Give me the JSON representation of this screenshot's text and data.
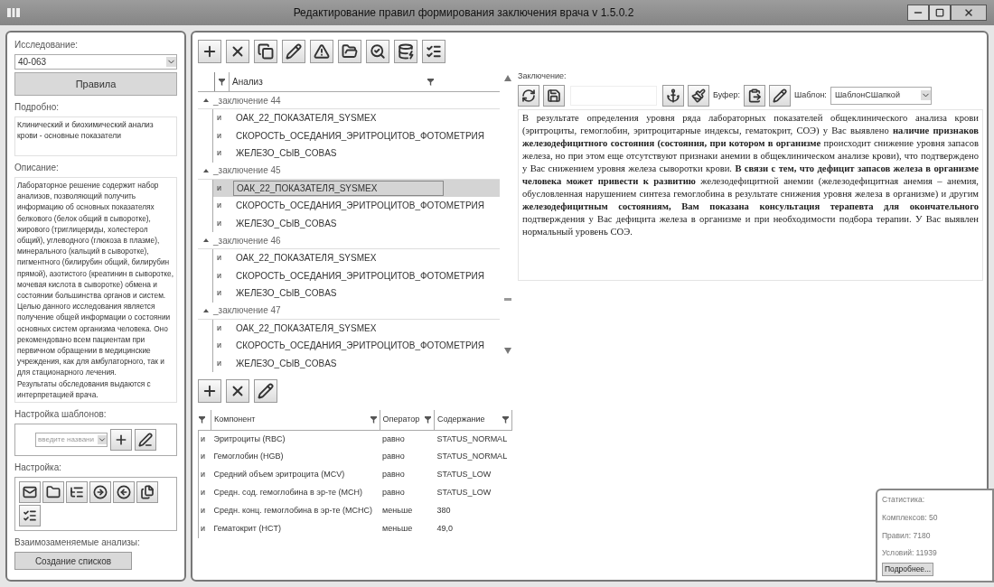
{
  "window": {
    "title": "Редактирование правил формирования заключения врача v 1.5.0.2"
  },
  "left": {
    "study_label": "Исследование:",
    "study_value": "40-063",
    "rules_button": "Правила",
    "details_label": "Подробно:",
    "details_text": "Клинический и биохимический анализ крови - основные показатели",
    "description_label": "Описание:",
    "description_text": "Лабораторное решение содержит набор анализов, позволяющий получить информацию об основных показателях белкового (белок общий в сыворотке), жирового (триглицериды, холестерол общий), углеводного (глюкоза в плазме), минерального (кальций в сыворотке), пигментного (билирубин общий, билирубин прямой), азотистого (креатинин в сыворотке, мочевая кислота в сыворотке) обмена и состоянии большинства органов и систем. Целью данного исследования является получение общей информации о состоянии основных систем организма человека. Оно рекомендовано всем пациентам при первичном обращении в медицинские учреждения, как для амбулаторного, так и для стационарного лечения.\nРезультаты обследования выдаются с интерпретацией врача.",
    "templates_label": "Настройка шаблонов:",
    "template_placeholder": "введите названи",
    "settings_label": "Настройка:",
    "interchangeable_label": "Взаимозаменяемые анализы:",
    "lists_button": "Создание списков"
  },
  "analysis": {
    "columns": [
      "Анализ"
    ],
    "groups": [
      {
        "title": "_заключение 44",
        "expanded": true,
        "rows": [
          {
            "op": "и",
            "name": "ОАК_22_ПОКАЗАТЕЛЯ_SYSMEX",
            "selected": false
          },
          {
            "op": "и",
            "name": "СКОРОСТЬ_ОСЕДАНИЯ_ЭРИТРОЦИТОВ_ФОТОМЕТРИЯ",
            "selected": false
          },
          {
            "op": "и",
            "name": "ЖЕЛЕЗО_СЫВ_COBAS",
            "selected": false
          }
        ]
      },
      {
        "title": "_заключение 45",
        "expanded": true,
        "rows": [
          {
            "op": "и",
            "name": "ОАК_22_ПОКАЗАТЕЛЯ_SYSMEX",
            "selected": true
          },
          {
            "op": "и",
            "name": "СКОРОСТЬ_ОСЕДАНИЯ_ЭРИТРОЦИТОВ_ФОТОМЕТРИЯ",
            "selected": false
          },
          {
            "op": "и",
            "name": "ЖЕЛЕЗО_СЫВ_COBAS",
            "selected": false
          }
        ]
      },
      {
        "title": "_заключение 46",
        "expanded": true,
        "rows": [
          {
            "op": "и",
            "name": "ОАК_22_ПОКАЗАТЕЛЯ_SYSMEX",
            "selected": false
          },
          {
            "op": "и",
            "name": "СКОРОСТЬ_ОСЕДАНИЯ_ЭРИТРОЦИТОВ_ФОТОМЕТРИЯ",
            "selected": false
          },
          {
            "op": "и",
            "name": "ЖЕЛЕЗО_СЫВ_COBAS",
            "selected": false
          }
        ]
      },
      {
        "title": "_заключение 47",
        "expanded": true,
        "rows": [
          {
            "op": "и",
            "name": "ОАК_22_ПОКАЗАТЕЛЯ_SYSMEX",
            "selected": false
          },
          {
            "op": "и",
            "name": "СКОРОСТЬ_ОСЕДАНИЯ_ЭРИТРОЦИТОВ_ФОТОМЕТРИЯ",
            "selected": false
          },
          {
            "op": "и",
            "name": "ЖЕЛЕЗО_СЫВ_COBAS",
            "selected": false
          }
        ]
      }
    ]
  },
  "conditions": {
    "columns": [
      "Компонент",
      "Оператор",
      "Содержание"
    ],
    "rows": [
      {
        "op": "и",
        "component": "Эритроциты (RBC)",
        "operator": "равно",
        "value": "STATUS_NORMAL"
      },
      {
        "op": "и",
        "component": "Гемоглобин (HGB)",
        "operator": "равно",
        "value": "STATUS_NORMAL"
      },
      {
        "op": "и",
        "component": "Средний объем эритроцита (MCV)",
        "operator": "равно",
        "value": "STATUS_LOW"
      },
      {
        "op": "и",
        "component": "Средн. сод. гемоглобина в эр-те (MCH)",
        "operator": "равно",
        "value": "STATUS_LOW"
      },
      {
        "op": "и",
        "component": "Средн. конц. гемоглобина в эр-те (MCHC)",
        "operator": "меньше",
        "value": "380"
      },
      {
        "op": "и",
        "component": "Гематокрит (HCT)",
        "operator": "меньше",
        "value": "49,0"
      }
    ]
  },
  "conclusion": {
    "label": "Заключение:",
    "buffer_label": "Буфер:",
    "template_label": "Шаблон:",
    "template_value": "ШаблонСШапкой",
    "text": "В результате определения уровня ряда лабораторных показателей общеклинического анализа крови (эритроциты, гемоглобин, эритроцитарные индексы, гематокрит, СОЭ) у Вас выявлено **наличие признаков железодефицитного состояния (состояния, при котором в организме** происходит снижение уровня запасов железа, но при этом еще отсутствуют признаки анемии в общеклиническом анализе крови), что подтверждено у Вас снижением уровня железа сыворотки крови. **В связи с тем, что дефицит запасов железа в организме человека может привести к развитию** железодефицитной анемии (железодефицитная анемия – анемия, обусловленная нарушением синтеза гемоглобина в результате снижения уровня железа в организме) и другим **железодефицитным состояниям, Вам показана консультация терапевта для окончательного** подтверждения у Вас дефицита железа в организме и при необходимости подбора терапии. У Вас выявлен нормальный уровень СОЭ."
  },
  "stats": {
    "title": "Статистика:",
    "lines": [
      "Комплексов: 50",
      "Правил: 7180",
      "Условий: 11939"
    ],
    "button": "Подробнее..."
  }
}
